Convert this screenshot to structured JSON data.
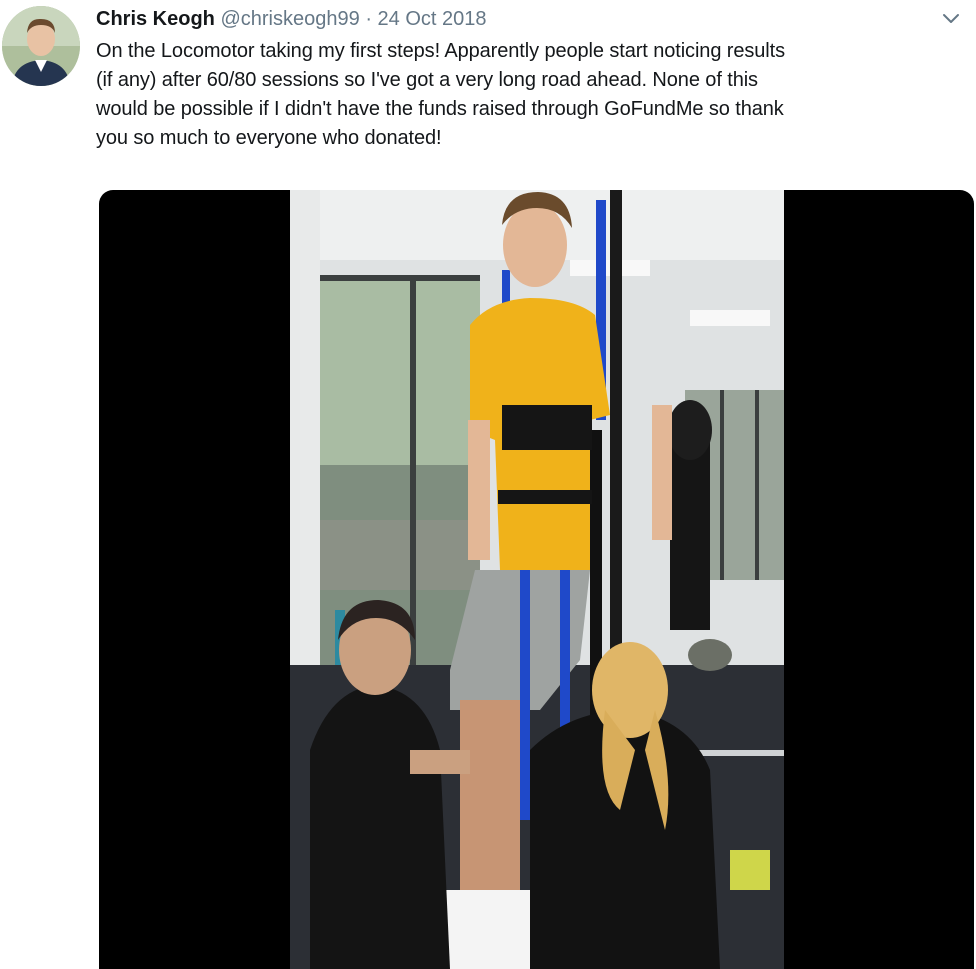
{
  "tweet": {
    "author_name": "Chris Keogh",
    "author_handle": "@chriskeogh99",
    "separator": "·",
    "date": "24 Oct 2018",
    "text": "On the Locomotor taking my first steps! Apparently people start noticing results\n(if any) after 60/80 sessions so I've got a very long road ahead. None of this\nwould be possible if I didn't have the funds raised through GoFundMe so thank\nyou so much to everyone who donated!"
  },
  "icons": {
    "menu": "chevron-down-icon"
  },
  "colors": {
    "name": "#14171a",
    "meta": "#657786",
    "media_background": "#000000"
  }
}
